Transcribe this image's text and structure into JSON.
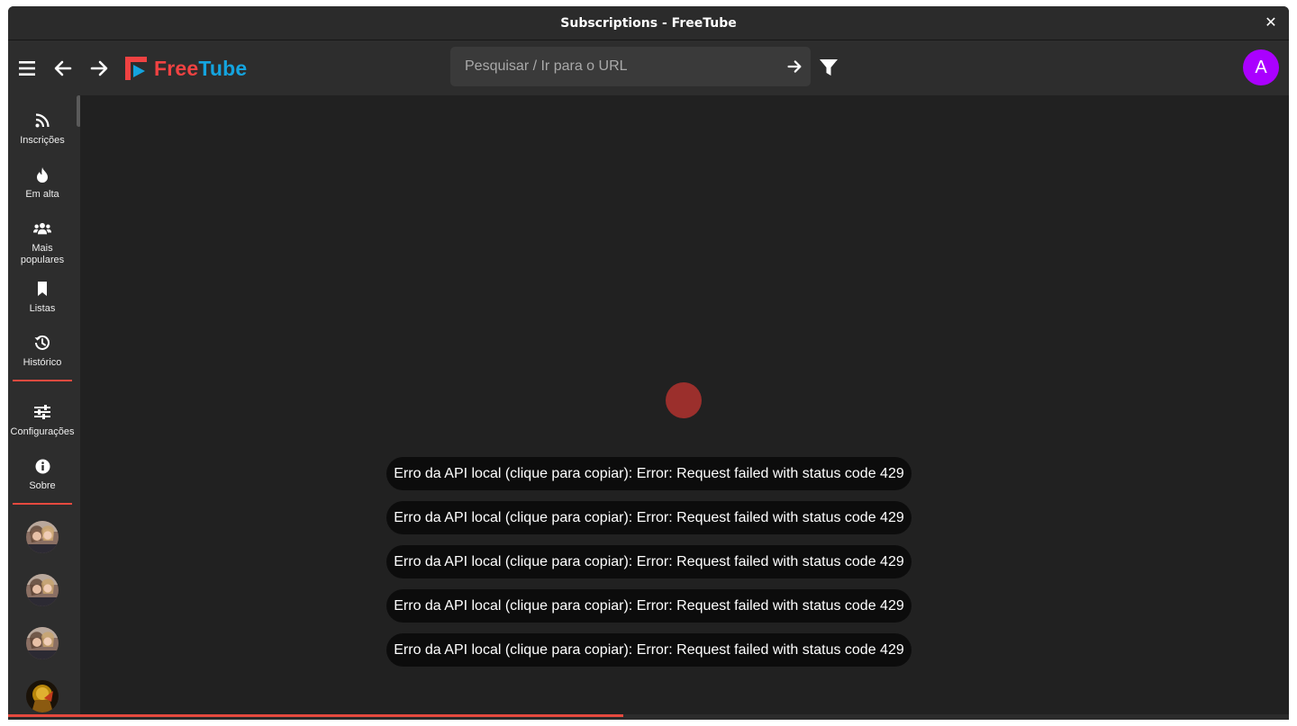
{
  "window": {
    "title": "Subscriptions - FreeTube",
    "close_glyph": "✕"
  },
  "topnav": {
    "menu_icon": "menu-icon",
    "back_icon": "arrow-left-icon",
    "forward_icon": "arrow-right-icon",
    "logo": {
      "free": "Free",
      "tube": "Tube"
    },
    "search": {
      "placeholder": "Pesquisar / Ir para o URL",
      "value": ""
    },
    "filter_icon": "filter-icon",
    "avatar_letter": "A",
    "avatar_color": "#aa00ff"
  },
  "sidebar": {
    "items": [
      {
        "id": "subscriptions",
        "label": "Inscrições",
        "icon": "rss-icon"
      },
      {
        "id": "trending",
        "label": "Em alta",
        "icon": "fire-icon"
      },
      {
        "id": "popular",
        "label": "Mais populares",
        "icon": "users-icon"
      },
      {
        "id": "playlists",
        "label": "Listas",
        "icon": "bookmark-icon"
      },
      {
        "id": "history",
        "label": "Histórico",
        "icon": "history-icon"
      },
      {
        "id": "settings",
        "label": "Configurações",
        "icon": "sliders-icon"
      },
      {
        "id": "about",
        "label": "Sobre",
        "icon": "info-icon"
      }
    ],
    "channels_count": 4
  },
  "main": {
    "toasts": [
      "Erro da API local (clique para copiar): Error: Request failed with status code 429",
      "Erro da API local (clique para copiar): Error: Request failed with status code 429",
      "Erro da API local (clique para copiar): Error: Request failed with status code 429",
      "Erro da API local (clique para copiar): Error: Request failed with status code 429",
      "Erro da API local (clique para copiar): Error: Request failed with status code 429"
    ],
    "loading_progress": 0.48
  },
  "colors": {
    "accent": "#e64a3f",
    "logo_red": "#f04242",
    "logo_blue": "#14a4df",
    "background": "#212121",
    "spinner": "#9b2f2c"
  }
}
